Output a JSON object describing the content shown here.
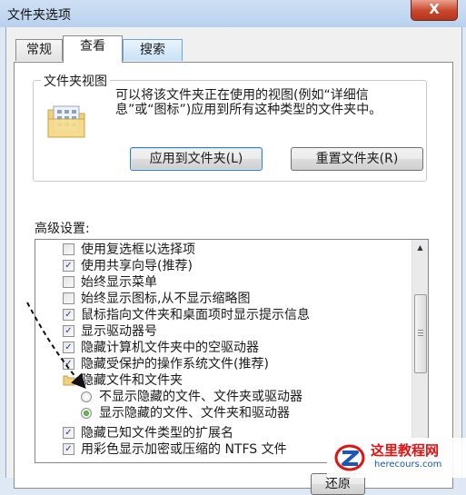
{
  "window": {
    "title": "文件夹选项",
    "close_label": "X"
  },
  "tabs": [
    {
      "label": "常规"
    },
    {
      "label": "查看"
    },
    {
      "label": "搜索"
    }
  ],
  "folder_views": {
    "group_title": "文件夹视图",
    "description": "可以将该文件夹正在使用的视图(例如“详细信息”或“图标”)应用到所有这种类型的文件夹中。",
    "apply_button": "应用到文件夹(L)",
    "reset_button": "重置文件夹(R)"
  },
  "advanced": {
    "label": "高级设置:",
    "items": [
      {
        "type": "checkbox",
        "checked": false,
        "label": "使用复选框以选择项"
      },
      {
        "type": "checkbox",
        "checked": true,
        "label": "使用共享向导(推荐)"
      },
      {
        "type": "checkbox",
        "checked": false,
        "label": "始终显示菜单"
      },
      {
        "type": "checkbox",
        "checked": false,
        "label": "始终显示图标,从不显示缩略图"
      },
      {
        "type": "checkbox",
        "checked": true,
        "label": "鼠标指向文件夹和桌面项时显示提示信息"
      },
      {
        "type": "checkbox",
        "checked": true,
        "label": "显示驱动器号"
      },
      {
        "type": "checkbox",
        "checked": true,
        "label": "隐藏计算机文件夹中的空驱动器"
      },
      {
        "type": "checkbox",
        "checked": true,
        "label": "隐藏受保护的操作系统文件(推荐)"
      },
      {
        "type": "folder",
        "label": "隐藏文件和文件夹"
      },
      {
        "type": "radio",
        "checked": false,
        "label": "不显示隐藏的文件、文件夹或驱动器"
      },
      {
        "type": "radio",
        "checked": true,
        "label": "显示隐藏的文件、文件夹和驱动器"
      },
      {
        "type": "checkbox",
        "checked": true,
        "label": "隐藏已知文件类型的扩展名"
      },
      {
        "type": "checkbox",
        "checked": true,
        "label": "用彩色显示加密或压缩的 NTFS 文件"
      }
    ]
  },
  "footer": {
    "restore_button_partial": "还原"
  },
  "watermark": {
    "title": "这里教程网",
    "url": "herecours.com"
  },
  "icons": {
    "close": "close-icon",
    "folder": "folder-icon",
    "scroll_up": "scroll-up-arrow-icon",
    "scroll_down": "scroll-down-arrow-icon"
  }
}
